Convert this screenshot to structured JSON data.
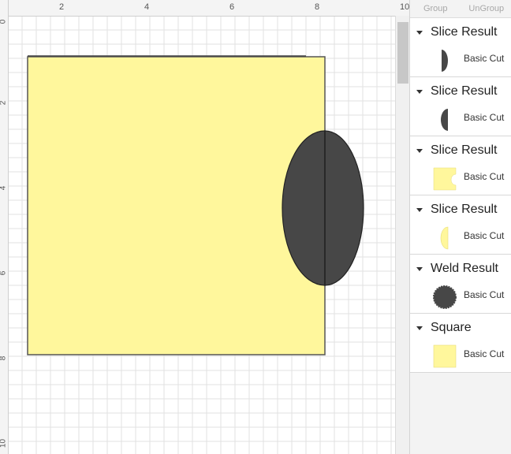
{
  "toolbar": {
    "group_label": "Group",
    "ungroup_label": "UnGroup"
  },
  "ruler": {
    "top_labels": [
      "2",
      "4",
      "6",
      "8",
      "10"
    ],
    "left_labels": [
      "0",
      "2",
      "4",
      "6",
      "8",
      "10"
    ]
  },
  "colors": {
    "square_fill": "#fff79c",
    "ellipse_fill": "#474747",
    "grid_line": "#e2e2e2"
  },
  "layers": [
    {
      "name": "Slice Result",
      "operation": "Basic Cut",
      "icon": "dark-half-right-icon"
    },
    {
      "name": "Slice Result",
      "operation": "Basic Cut",
      "icon": "dark-half-left-icon"
    },
    {
      "name": "Slice Result",
      "operation": "Basic Cut",
      "icon": "notched-square-icon"
    },
    {
      "name": "Slice Result",
      "operation": "Basic Cut",
      "icon": "yellow-half-icon"
    },
    {
      "name": "Weld Result",
      "operation": "Basic Cut",
      "icon": "scalloped-circle-icon"
    },
    {
      "name": "Square",
      "operation": "Basic Cut",
      "icon": "square-icon"
    }
  ]
}
